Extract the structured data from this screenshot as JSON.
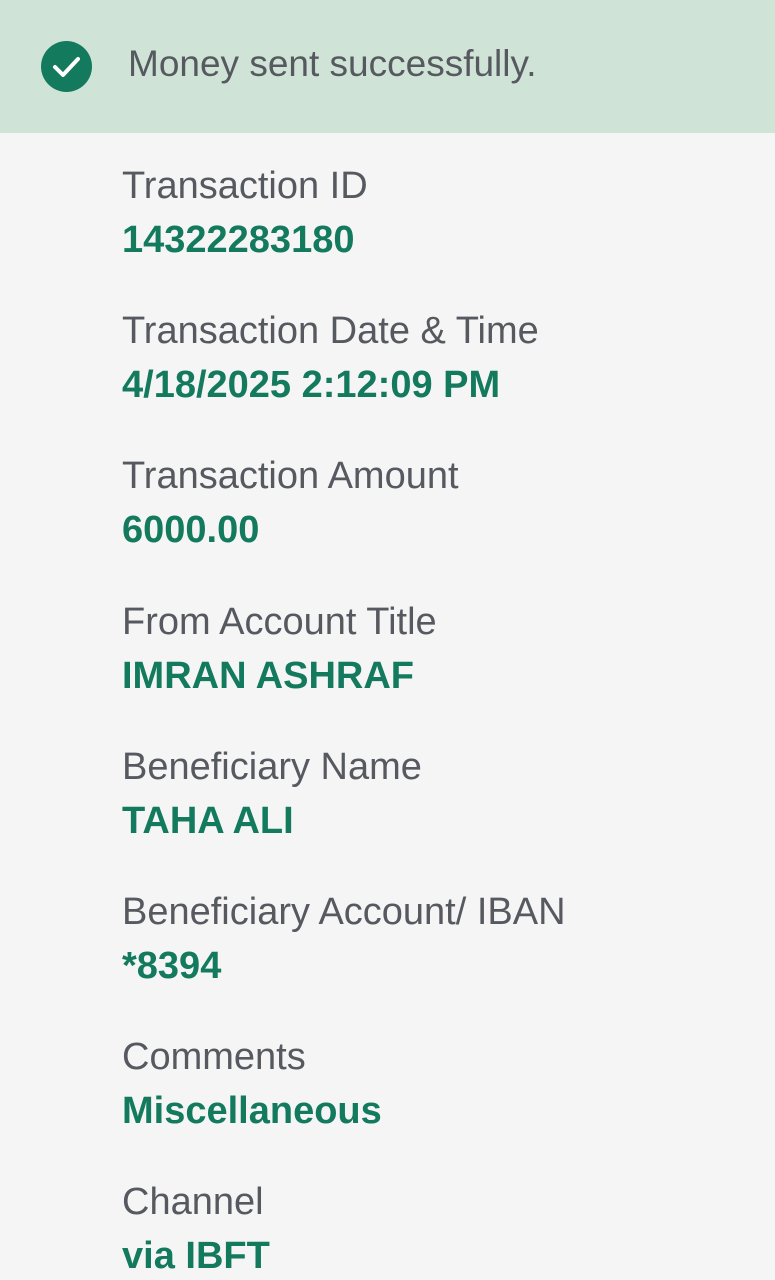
{
  "banner": {
    "icon": "check-circle-icon",
    "message": "Money sent successfully."
  },
  "colors": {
    "accent": "#137a5e",
    "banner_bg": "#cfe4d6",
    "label_text": "#56595f",
    "page_bg": "#f5f5f5"
  },
  "details": [
    {
      "label": "Transaction ID",
      "value": "14322283180"
    },
    {
      "label": "Transaction Date & Time",
      "value": "4/18/2025 2:12:09 PM"
    },
    {
      "label": "Transaction Amount",
      "value": "6000.00"
    },
    {
      "label": "From Account Title",
      "value": "IMRAN ASHRAF"
    },
    {
      "label": "Beneficiary Name",
      "value": "TAHA ALI"
    },
    {
      "label": "Beneficiary Account/ IBAN",
      "value": "*8394"
    },
    {
      "label": "Comments",
      "value": "Miscellaneous"
    },
    {
      "label": "Channel",
      "value": "via IBFT"
    }
  ]
}
